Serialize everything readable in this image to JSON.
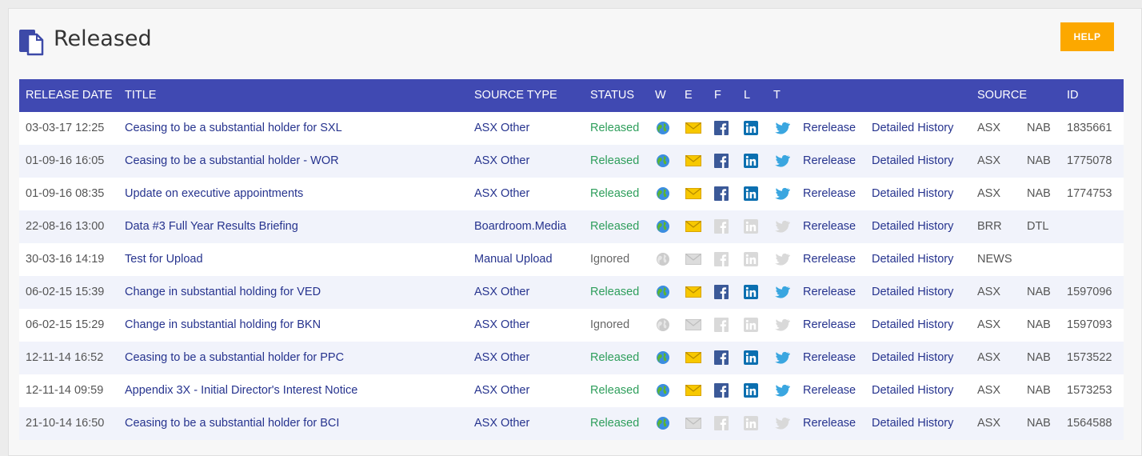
{
  "page": {
    "title": "Released",
    "help_label": "HELP"
  },
  "colors": {
    "header_bg": "#4049b2",
    "help_bg": "#fca800",
    "link": "#26338e",
    "released": "#2e9e5b"
  },
  "columns": {
    "release_date": "RELEASE DATE",
    "title": "TITLE",
    "source_type": "SOURCE TYPE",
    "status": "STATUS",
    "w": "W",
    "e": "E",
    "f": "F",
    "l": "L",
    "t": "T",
    "source": "SOURCE",
    "id": "ID"
  },
  "rows": [
    {
      "date": "03-03-17 12:25",
      "title": "Ceasing to be a substantial holder for SXL",
      "source_type": "ASX Other",
      "status": "Released",
      "w": true,
      "e": true,
      "f": true,
      "l": true,
      "t": true,
      "rerelease": "Rerelease",
      "history": "Detailed History",
      "source": "ASX",
      "source2": "NAB",
      "id": "1835661"
    },
    {
      "date": "01-09-16 16:05",
      "title": "Ceasing to be a substantial holder - WOR",
      "source_type": "ASX Other",
      "status": "Released",
      "w": true,
      "e": true,
      "f": true,
      "l": true,
      "t": true,
      "rerelease": "Rerelease",
      "history": "Detailed History",
      "source": "ASX",
      "source2": "NAB",
      "id": "1775078"
    },
    {
      "date": "01-09-16 08:35",
      "title": "Update on executive appointments",
      "source_type": "ASX Other",
      "status": "Released",
      "w": true,
      "e": true,
      "f": true,
      "l": true,
      "t": true,
      "rerelease": "Rerelease",
      "history": "Detailed History",
      "source": "ASX",
      "source2": "NAB",
      "id": "1774753"
    },
    {
      "date": "22-08-16 13:00",
      "title": "Data #3 Full Year Results Briefing",
      "source_type": "Boardroom.Media",
      "status": "Released",
      "w": true,
      "e": true,
      "f": false,
      "l": false,
      "t": false,
      "rerelease": "Rerelease",
      "history": "Detailed History",
      "source": "BRR",
      "source2": "DTL",
      "id": ""
    },
    {
      "date": "30-03-16 14:19",
      "title": "Test for Upload",
      "source_type": "Manual Upload",
      "status": "Ignored",
      "w": false,
      "e": false,
      "f": false,
      "l": false,
      "t": false,
      "rerelease": "Rerelease",
      "history": "Detailed History",
      "source": "NEWS",
      "source2": "",
      "id": ""
    },
    {
      "date": "06-02-15 15:39",
      "title": "Change in substantial holding for VED",
      "source_type": "ASX Other",
      "status": "Released",
      "w": true,
      "e": true,
      "f": true,
      "l": true,
      "t": true,
      "rerelease": "Rerelease",
      "history": "Detailed History",
      "source": "ASX",
      "source2": "NAB",
      "id": "1597096"
    },
    {
      "date": "06-02-15 15:29",
      "title": "Change in substantial holding for BKN",
      "source_type": "ASX Other",
      "status": "Ignored",
      "w": false,
      "e": false,
      "f": false,
      "l": false,
      "t": false,
      "rerelease": "Rerelease",
      "history": "Detailed History",
      "source": "ASX",
      "source2": "NAB",
      "id": "1597093"
    },
    {
      "date": "12-11-14 16:52",
      "title": "Ceasing to be a substantial holder for PPC",
      "source_type": "ASX Other",
      "status": "Released",
      "w": true,
      "e": true,
      "f": true,
      "l": true,
      "t": true,
      "rerelease": "Rerelease",
      "history": "Detailed History",
      "source": "ASX",
      "source2": "NAB",
      "id": "1573522"
    },
    {
      "date": "12-11-14 09:59",
      "title": "Appendix 3X - Initial Director's Interest Notice",
      "source_type": "ASX Other",
      "status": "Released",
      "w": true,
      "e": true,
      "f": true,
      "l": true,
      "t": true,
      "rerelease": "Rerelease",
      "history": "Detailed History",
      "source": "ASX",
      "source2": "NAB",
      "id": "1573253"
    },
    {
      "date": "21-10-14 16:50",
      "title": "Ceasing to be a substantial holder for BCI",
      "source_type": "ASX Other",
      "status": "Released",
      "w": true,
      "e": false,
      "f": false,
      "l": false,
      "t": false,
      "rerelease": "Rerelease",
      "history": "Detailed History",
      "source": "ASX",
      "source2": "NAB",
      "id": "1564588"
    }
  ]
}
